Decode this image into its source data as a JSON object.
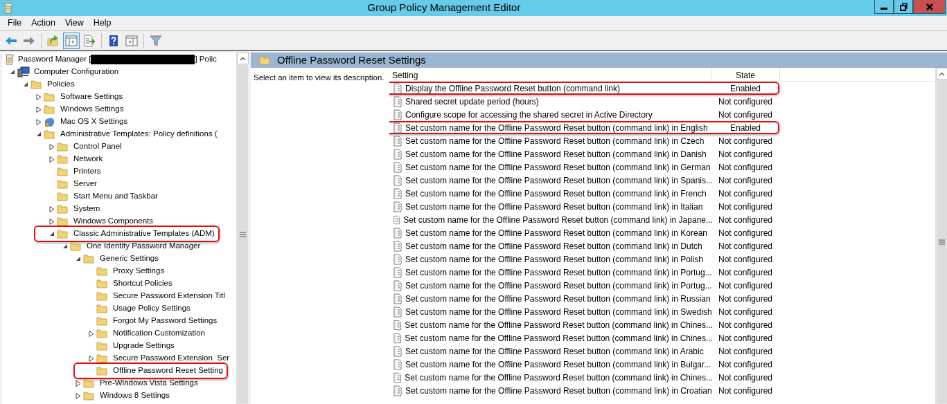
{
  "window": {
    "title": "Group Policy Management Editor"
  },
  "menu": [
    "File",
    "Action",
    "View",
    "Help"
  ],
  "toolbar": [
    {
      "kind": "back",
      "pressed": false
    },
    {
      "kind": "forward",
      "pressed": false
    },
    {
      "kind": "sep"
    },
    {
      "kind": "up",
      "pressed": false
    },
    {
      "kind": "tree",
      "pressed": true
    },
    {
      "kind": "export",
      "pressed": false
    },
    {
      "kind": "sep"
    },
    {
      "kind": "help",
      "pressed": false
    },
    {
      "kind": "pane",
      "pressed": false
    },
    {
      "kind": "sep"
    },
    {
      "kind": "filter",
      "pressed": false
    }
  ],
  "tree": {
    "root": {
      "text_before": "Password Manager [",
      "text_after": "] Polic",
      "redacted": true
    },
    "children": [
      {
        "label": "Computer Configuration",
        "kind": "computer",
        "expanded": true,
        "highlighted": false,
        "children": [
          {
            "label": "Policies",
            "expanded": true,
            "highlighted": false,
            "children": [
              {
                "label": "Software Settings",
                "expanded": false,
                "highlighted": false
              },
              {
                "label": "Windows Settings",
                "expanded": false,
                "highlighted": false
              },
              {
                "label": "Mac OS X Settings",
                "kind": "mac",
                "expanded": false,
                "highlighted": false
              },
              {
                "label": "Administrative Templates: Policy definitions (",
                "expanded": true,
                "highlighted": false,
                "children": [
                  {
                    "label": "Control Panel",
                    "expanded": false,
                    "highlighted": false
                  },
                  {
                    "label": "Network",
                    "expanded": false,
                    "highlighted": false
                  },
                  {
                    "label": "Printers",
                    "highlighted": false
                  },
                  {
                    "label": "Server",
                    "highlighted": false
                  },
                  {
                    "label": "Start Menu and Taskbar",
                    "highlighted": false
                  },
                  {
                    "label": "System",
                    "expanded": false,
                    "highlighted": false
                  },
                  {
                    "label": "Windows Components",
                    "expanded": false,
                    "highlighted": false
                  },
                  {
                    "label": "Classic Administrative Templates (ADM)",
                    "expanded": true,
                    "highlighted": true,
                    "children": [
                      {
                        "label": "One Identity Password Manager",
                        "expanded": true,
                        "highlighted": false,
                        "children": [
                          {
                            "label": "Generic Settings",
                            "expanded": true,
                            "highlighted": false,
                            "children": [
                              {
                                "label": "Proxy Settings",
                                "highlighted": false
                              },
                              {
                                "label": "Shortcut Policies",
                                "highlighted": false
                              },
                              {
                                "label": "Secure Password Extension Titl",
                                "highlighted": false
                              },
                              {
                                "label": "Usage Policy Settings",
                                "highlighted": false
                              },
                              {
                                "label": "Forgot My Password Settings",
                                "highlighted": false
                              },
                              {
                                "label": "Notification Customization",
                                "expanded": false,
                                "highlighted": false
                              },
                              {
                                "label": "Upgrade Settings",
                                "highlighted": false
                              },
                              {
                                "label": "Secure Password Extension  Ser",
                                "expanded": false,
                                "highlighted": false
                              },
                              {
                                "label": "Offline Password Reset Setting",
                                "highlighted": true
                              }
                            ]
                          },
                          {
                            "label": "Pre-Windows Vista Settings",
                            "expanded": false,
                            "highlighted": false
                          },
                          {
                            "label": "Windows 8 Settings",
                            "expanded": false,
                            "highlighted": false
                          }
                        ]
                      }
                    ]
                  }
                ]
              }
            ]
          }
        ]
      }
    ]
  },
  "details": {
    "title": "Offline Password Reset Settings",
    "description": "Select an item to view its description.",
    "columns": [
      "Setting",
      "State"
    ],
    "rows": [
      {
        "setting": "Display the Offline Password Reset button (command link)",
        "state": "Enabled",
        "highlighted": true
      },
      {
        "setting": "Shared secret update period (hours)",
        "state": "Not configured",
        "highlighted": false
      },
      {
        "setting": "Configure scope for accessing the shared secret in Active Directory",
        "state": "Not configured",
        "highlighted": false
      },
      {
        "setting": "Set custom name for the Offline Password Reset button (command link) in English",
        "state": "Enabled",
        "highlighted": true
      },
      {
        "setting": "Set custom name for the Offline Password Reset button (command link) in Czech",
        "state": "Not configured",
        "highlighted": false
      },
      {
        "setting": "Set custom name for the Offline Password Reset button (command link) in Danish",
        "state": "Not configured",
        "highlighted": false
      },
      {
        "setting": "Set custom name for the Offline Password Reset button (command link) in German",
        "state": "Not configured",
        "highlighted": false
      },
      {
        "setting": "Set custom name for the Offline Password Reset button (command link) in Spanis...",
        "state": "Not configured",
        "highlighted": false
      },
      {
        "setting": "Set custom name for the Offline Password Reset button (command link) in French",
        "state": "Not configured",
        "highlighted": false
      },
      {
        "setting": "Set custom name for the Offline Password Reset button (command link) in Italian",
        "state": "Not configured",
        "highlighted": false
      },
      {
        "setting": "Set custom name for the Offline Password Reset button (command link) in Japane...",
        "state": "Not configured",
        "highlighted": false
      },
      {
        "setting": "Set custom name for the Offline Password Reset button (command link) in Korean",
        "state": "Not configured",
        "highlighted": false
      },
      {
        "setting": "Set custom name for the Offline Password Reset button (command link) in Dutch",
        "state": "Not configured",
        "highlighted": false
      },
      {
        "setting": "Set custom name for the Offline Password Reset button (command link) in Polish",
        "state": "Not configured",
        "highlighted": false
      },
      {
        "setting": "Set custom name for the Offline Password Reset button (command link) in Portug...",
        "state": "Not configured",
        "highlighted": false
      },
      {
        "setting": "Set custom name for the Offline Password Reset button (command link) in Portug...",
        "state": "Not configured",
        "highlighted": false
      },
      {
        "setting": "Set custom name for the Offline Password Reset button (command link) in Russian",
        "state": "Not configured",
        "highlighted": false
      },
      {
        "setting": "Set custom name for the Offline Password Reset button (command link) in Swedish",
        "state": "Not configured",
        "highlighted": false
      },
      {
        "setting": "Set custom name for the Offline Password Reset button (command link) in Chines...",
        "state": "Not configured",
        "highlighted": false
      },
      {
        "setting": "Set custom name for the Offline Password Reset button (command link) in Chines...",
        "state": "Not configured",
        "highlighted": false
      },
      {
        "setting": "Set custom name for the Offline Password Reset button (command link) in Arabic",
        "state": "Not configured",
        "highlighted": false
      },
      {
        "setting": "Set custom name for the Offline Password Reset button (command link) in Bulgar...",
        "state": "Not configured",
        "highlighted": false
      },
      {
        "setting": "Set custom name for the Offline Password Reset button (command link) in Chines...",
        "state": "Not configured",
        "highlighted": false
      },
      {
        "setting": "Set custom name for the Offline Password Reset button (command link) in Croatian",
        "state": "Not configured",
        "highlighted": false
      }
    ]
  }
}
